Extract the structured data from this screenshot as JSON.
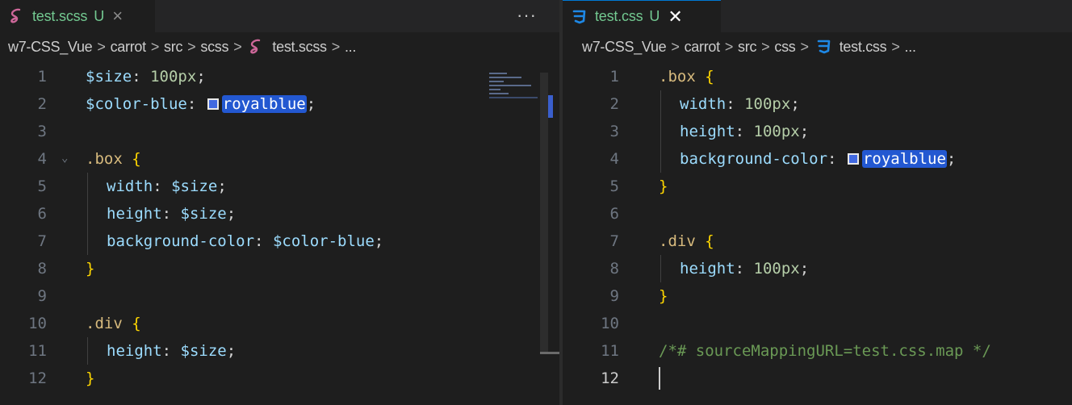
{
  "left_pane": {
    "tab": {
      "label": "test.scss",
      "status": "U",
      "close_glyph": "×",
      "icon": "sass-icon"
    },
    "more_actions": "···",
    "breadcrumb": [
      "w7-CSS_Vue",
      "carrot",
      "src",
      "scss",
      "test.scss",
      "..."
    ],
    "breadcrumb_sep": ">",
    "line_numbers": [
      "1",
      "2",
      "3",
      "4",
      "5",
      "6",
      "7",
      "8",
      "9",
      "10",
      "11",
      "12"
    ],
    "code": {
      "l1_var": "$size",
      "l1_colon": ":",
      "l1_num": "100px",
      "l1_semi": ";",
      "l2_var": "$color-blue",
      "l2_colon": ":",
      "l2_color": "royalblue",
      "l2_semi": ";",
      "l4_sel": ".box",
      "l4_brace": "{",
      "l5_prop": "width",
      "l5_colon": ":",
      "l5_val": "$size",
      "l5_semi": ";",
      "l6_prop": "height",
      "l6_colon": ":",
      "l6_val": "$size",
      "l6_semi": ";",
      "l7_prop": "background-color",
      "l7_colon": ":",
      "l7_val": "$color-blue",
      "l7_semi": ";",
      "l8_brace": "}",
      "l10_sel": ".div",
      "l10_brace": "{",
      "l11_prop": "height",
      "l11_colon": ":",
      "l11_val": "$size",
      "l11_semi": ";",
      "l12_brace": "}"
    }
  },
  "right_pane": {
    "tab": {
      "label": "test.css",
      "status": "U",
      "close_glyph": "✕",
      "icon": "css3-icon"
    },
    "breadcrumb": [
      "w7-CSS_Vue",
      "carrot",
      "src",
      "css",
      "test.css",
      "..."
    ],
    "breadcrumb_sep": ">",
    "line_numbers": [
      "1",
      "2",
      "3",
      "4",
      "5",
      "6",
      "7",
      "8",
      "9",
      "10",
      "11",
      "12"
    ],
    "active_line": "12",
    "code": {
      "l1_sel": ".box",
      "l1_brace": "{",
      "l2_prop": "width",
      "l2_colon": ":",
      "l2_num": "100px",
      "l2_semi": ";",
      "l3_prop": "height",
      "l3_colon": ":",
      "l3_num": "100px",
      "l3_semi": ";",
      "l4_prop": "background-color",
      "l4_colon": ":",
      "l4_color": "royalblue",
      "l4_semi": ";",
      "l5_brace": "}",
      "l7_sel": ".div",
      "l7_brace": "{",
      "l8_prop": "height",
      "l8_colon": ":",
      "l8_num": "100px",
      "l8_semi": ";",
      "l9_brace": "}",
      "l11_comment": "/*# sourceMappingURL=test.css.map */"
    }
  },
  "colors": {
    "royalblue_swatch": "#4169e1",
    "untracked_green": "#73c991",
    "sass_pink": "#cd6799",
    "css_blue": "#1e88e5"
  }
}
